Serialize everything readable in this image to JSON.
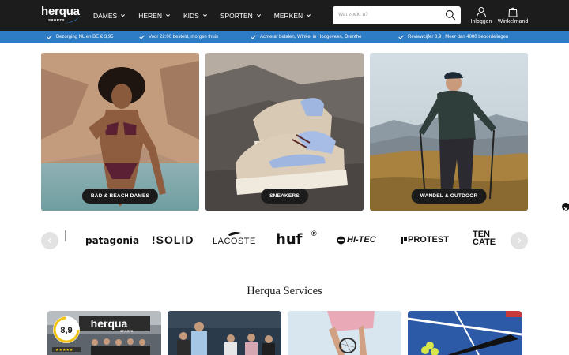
{
  "header": {
    "logo": {
      "main": "herqua",
      "sub": "SPORTS"
    },
    "nav": [
      {
        "label": "DAMES"
      },
      {
        "label": "HEREN"
      },
      {
        "label": "KIDS"
      },
      {
        "label": "SPORTEN"
      },
      {
        "label": "MERKEN"
      }
    ],
    "search": {
      "placeholder": "Wat zoekt u?"
    },
    "login_label": "Inloggen",
    "cart_label": "Winkelmand"
  },
  "usp": [
    {
      "text": "Bezorging NL en BE € 3,95"
    },
    {
      "text": "Voor 22:00 besteld, morgen thuis"
    },
    {
      "text": "Achteraf betalen, Winkel in Hoogeveen, Drenthe"
    },
    {
      "text": "Reviewcijfer 8,9 | Meer dan 4000 beoordelingen"
    }
  ],
  "categories": [
    {
      "label": "BAD & BEACH DAMES"
    },
    {
      "label": "SNEAKERS"
    },
    {
      "label": "WANDEL & OUTDOOR"
    }
  ],
  "brands": [
    {
      "name": "patagonia"
    },
    {
      "name": "!SOLID"
    },
    {
      "name": "LACOSTE"
    },
    {
      "name": "huf"
    },
    {
      "name": "HI-TEC"
    },
    {
      "name": "PROTEST"
    },
    {
      "name": "TEN CATE"
    }
  ],
  "services": {
    "title": "Herqua Services",
    "review_score": "8,9",
    "store_sign": "herqua",
    "store_sign_sub": "SPORTS"
  },
  "colors": {
    "header_bg": "#1c1c1c",
    "usp_bg": "#2e7cc6",
    "label_bg": "#1b1b1b"
  },
  "icons": [
    "chevron-down-icon",
    "search-icon",
    "user-icon",
    "shopping-bag-icon",
    "check-icon",
    "chevron-left-icon",
    "chevron-right-icon",
    "close-icon"
  ]
}
